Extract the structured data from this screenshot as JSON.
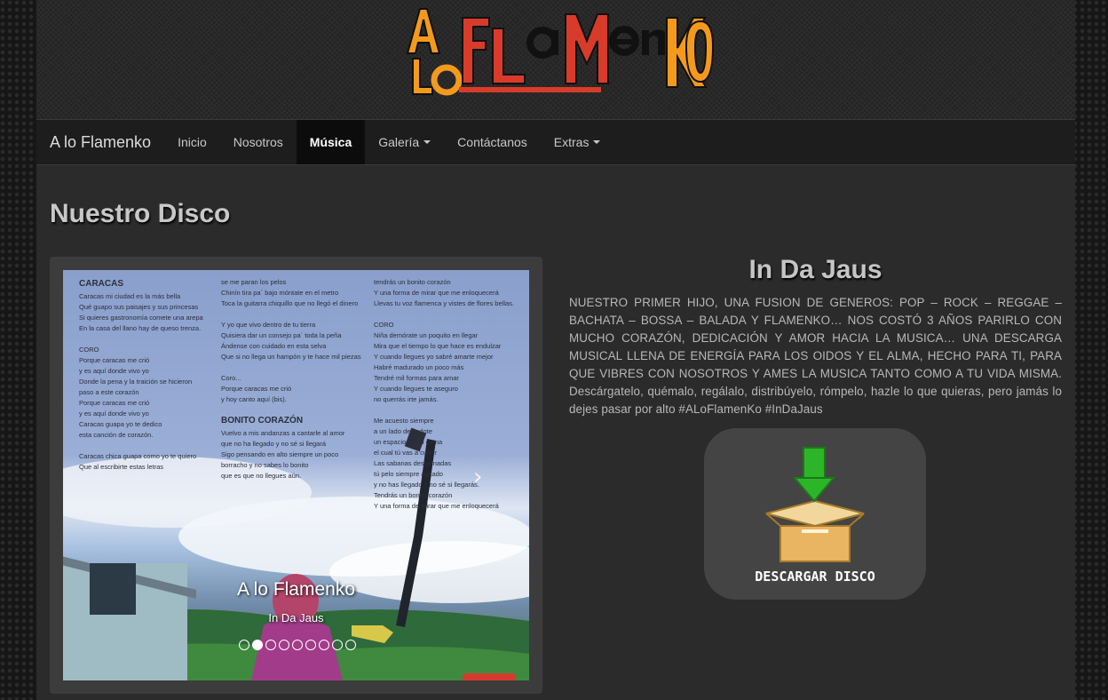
{
  "header": {
    "logo_text": "A lo FlaMenKo"
  },
  "navbar": {
    "brand": "A lo Flamenko",
    "items": [
      {
        "label": "Inicio",
        "active": false,
        "dropdown": false
      },
      {
        "label": "Nosotros",
        "active": false,
        "dropdown": false
      },
      {
        "label": "Música",
        "active": true,
        "dropdown": false
      },
      {
        "label": "Galería",
        "active": false,
        "dropdown": true
      },
      {
        "label": "Contáctanos",
        "active": false,
        "dropdown": false
      },
      {
        "label": "Extras",
        "active": false,
        "dropdown": true
      }
    ]
  },
  "main": {
    "page_title": "Nuestro Disco",
    "carousel": {
      "caption_title": "A lo Flamenko",
      "caption_subtitle": "In Da Jaus",
      "slide_count": 9,
      "active_index": 1,
      "lyrics": {
        "col1": [
          "CARACAS",
          "Caracas mi ciudad es la más bella",
          "Qué guapo sus paisajes y sus princesas",
          "Si quieres gastronomía comete una arepa",
          "En la casa del llano hay de queso trenza.",
          "",
          "CORO",
          "Porque caracas me crió",
          "y es aquí donde vivo yo",
          "Donde la pena y la traición se hicieron",
          "paso a este corazón",
          "Porque caracas me crió",
          "y es aquí donde vivo yo",
          "Caracas guapa yo te dedico",
          "esta canción de corazón.",
          "",
          "Caracas chica guapa como yo te quiero",
          "Que al escribirte estas letras"
        ],
        "col2": [
          "se me paran los pelos",
          "Chinín tira pa´ bajo móntate en el metro",
          "Toca la guitarra chiquillo que no llegó el dinero",
          "",
          "Y yo que vivo dentro de tu tierra",
          "Quisiera dar un consejo pa´ toda la peña",
          "Ándense con cuidado en esta selva",
          "Que si no llega un hampón y te hace mil piezas",
          "",
          "Coro...",
          "Porque caracas me crió",
          "y hoy canto aquí (bis).",
          "",
          "BONITO CORAZÓN",
          "Vuelvo a mis andanzas a cantarle al amor",
          "que no ha llegado y no sé si llegará",
          "Sigo pensando en alto siempre un poco",
          "borracho y no sabes lo bonito",
          "que es que no llegues aún."
        ],
        "col3": [
          "tendrás un bonito corazón",
          "Y una forma de mirar que me enloquecerá",
          "Llevas tu voz flamenca y vistes de flores bellas.",
          "",
          "CORO",
          "Niña demórate un poquito en llegar",
          "Mira que el tiempo lo que hace es endulzar",
          "Y cuando llegues yo sabré amarte mejor",
          "Habré madurado un poco más",
          "Tendré mil formas para amar",
          "Y cuando llegues te aseguro",
          "no querrás irte jamás.",
          "",
          "Me acuesto siempre",
          "a un lado dejándote",
          "un espacio en mi cama",
          "el cual tú vas a cubrir",
          "Las sabanas despeinadas",
          "tú pelo siempre agitado",
          "y no has llegado y no sé si llegarás.",
          "Tendrás un bonito corazón",
          "Y una forma de mirar que me enloquecerá"
        ]
      }
    },
    "album": {
      "title": "In Da Jaus",
      "description": "NUESTRO PRIMER HIJO, UNA FUSION DE GENEROS: POP – ROCK – REGGAE – BACHATA – BOSSA – BALADA Y FLAMENKO… NOS COSTÓ 3 AÑOS PARIRLO CON MUCHO CORAZÓN, DEDICACIÓN Y AMOR HACIA LA MUSICA… UNA DESCARGA MUSICAL LLENA DE ENERGÍA PARA LOS OIDOS Y EL ALMA, HECHO PARA TI, PARA QUE VIBRES CON NOSOTROS Y AMES LA MUSICA TANTO COMO A TU VIDA MISMA. Descárgatelo, quémalo, regálalo, distribúyelo, rómpelo, hazle lo que quieras, pero jamás lo dejes pasar por alto #ALoFlamenKo #InDaJaus",
      "download_label": "DESCARGAR DISCO"
    }
  },
  "colors": {
    "logo_orange": "#f39a1d",
    "logo_red": "#d93b2a",
    "download_arrow": "#2db52a",
    "box_tan": "#e6b86a"
  },
  "icons": {
    "download": "download-box-icon",
    "next": "chevron-right-icon"
  }
}
